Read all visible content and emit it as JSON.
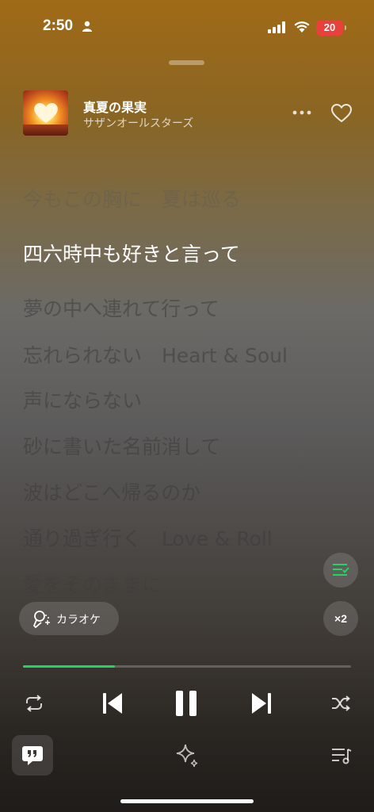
{
  "status_bar": {
    "time": "2:50",
    "battery": "20",
    "battery_color": "#e8413c"
  },
  "track": {
    "title": "真夏の果実",
    "artist": "サザンオールスターズ"
  },
  "lyrics": [
    {
      "text": "今もこの胸に　夏は巡る",
      "state": "past"
    },
    {
      "text": "四六時中も好きと言って",
      "state": "current"
    },
    {
      "text": "夢の中へ連れて行って",
      "state": "upcoming"
    },
    {
      "text": "忘れられない　Heart & Soul",
      "state": "upcoming"
    },
    {
      "text": "声にならない",
      "state": "upcoming"
    },
    {
      "text": "砂に書いた名前消して",
      "state": "upcoming"
    },
    {
      "text": "波はどこへ帰るのか",
      "state": "upcoming"
    },
    {
      "text": "通り過ぎ行く　Love & Roll",
      "state": "upcoming"
    },
    {
      "text": "愛をそのままに",
      "state": "upcoming"
    }
  ],
  "controls": {
    "karaoke_label": "カラオケ",
    "speed_label": "×2",
    "progress_fraction": 0.28,
    "accent_color": "#1ed760"
  },
  "icons": {
    "person": "person-icon",
    "signal": "cellular-signal-icon",
    "wifi": "wifi-icon",
    "more": "more-options-icon",
    "heart": "heart-icon",
    "karaoke": "karaoke-mic-icon",
    "lyrics_list": "lyrics-list-icon",
    "repeat": "repeat-icon",
    "previous": "previous-track-icon",
    "pause": "pause-icon",
    "next": "next-track-icon",
    "shuffle": "shuffle-icon",
    "lyrics_quote": "lyrics-quote-icon",
    "sparkle": "sparkle-icon",
    "queue": "queue-icon"
  }
}
